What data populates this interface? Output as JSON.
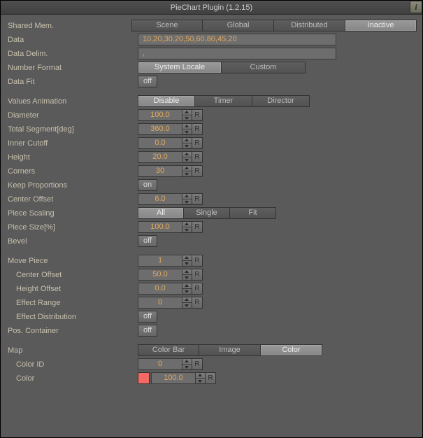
{
  "title": "PieChart Plugin (1.2.15)",
  "info_icon": "i",
  "header": {
    "shared_mem_label": "Shared Mem.",
    "tabs": {
      "scene": "Scene",
      "global": "Global",
      "distributed": "Distributed",
      "inactive": "Inactive"
    }
  },
  "data_section": {
    "data_label": "Data",
    "data_value": "10,20,30,20,50,60,80,45,20",
    "delim_label": "Data Delim.",
    "delim_value": ",",
    "numfmt_label": "Number Format",
    "numfmt": {
      "system": "System Locale",
      "custom": "Custom"
    },
    "datafit_label": "Data Fit",
    "datafit_value": "off"
  },
  "anim": {
    "label": "Values Animation",
    "opts": {
      "disable": "Disable",
      "timer": "Timer",
      "director": "Director"
    }
  },
  "geom": {
    "diameter_label": "Diameter",
    "diameter": "100.0",
    "totalseg_label": "Total Segment[deg]",
    "totalseg": "360.0",
    "inner_label": "Inner Cutoff",
    "inner": "0.0",
    "height_label": "Height",
    "height": "20.0",
    "corners_label": "Corners",
    "corners": "30",
    "keepprop_label": "Keep Proportions",
    "keepprop": "on",
    "centeroff_label": "Center Offset",
    "centeroff": "6.0"
  },
  "piece": {
    "scaling_label": "Piece Scaling",
    "scaling": {
      "all": "All",
      "single": "Single",
      "fit": "Fit"
    },
    "size_label": "Piece Size[%]",
    "size": "100.0",
    "bevel_label": "Bevel",
    "bevel": "off"
  },
  "move": {
    "movepiece_label": "Move Piece",
    "movepiece": "1",
    "centeroff_label": "Center Offset",
    "centeroff": "50.0",
    "heightoff_label": "Height Offset",
    "heightoff": "0.0",
    "effrange_label": "Effect Range",
    "effrange": "0",
    "effdist_label": "Effect Distribution",
    "effdist": "off",
    "poscont_label": "Pos. Container",
    "poscont": "off"
  },
  "map": {
    "label": "Map",
    "opts": {
      "colorbar": "Color Bar",
      "image": "Image",
      "color": "Color"
    },
    "colorid_label": "Color ID",
    "colorid": "0",
    "color_label": "Color",
    "color_value": "100.0",
    "swatch": "#f26a62"
  },
  "reset_label": "R"
}
